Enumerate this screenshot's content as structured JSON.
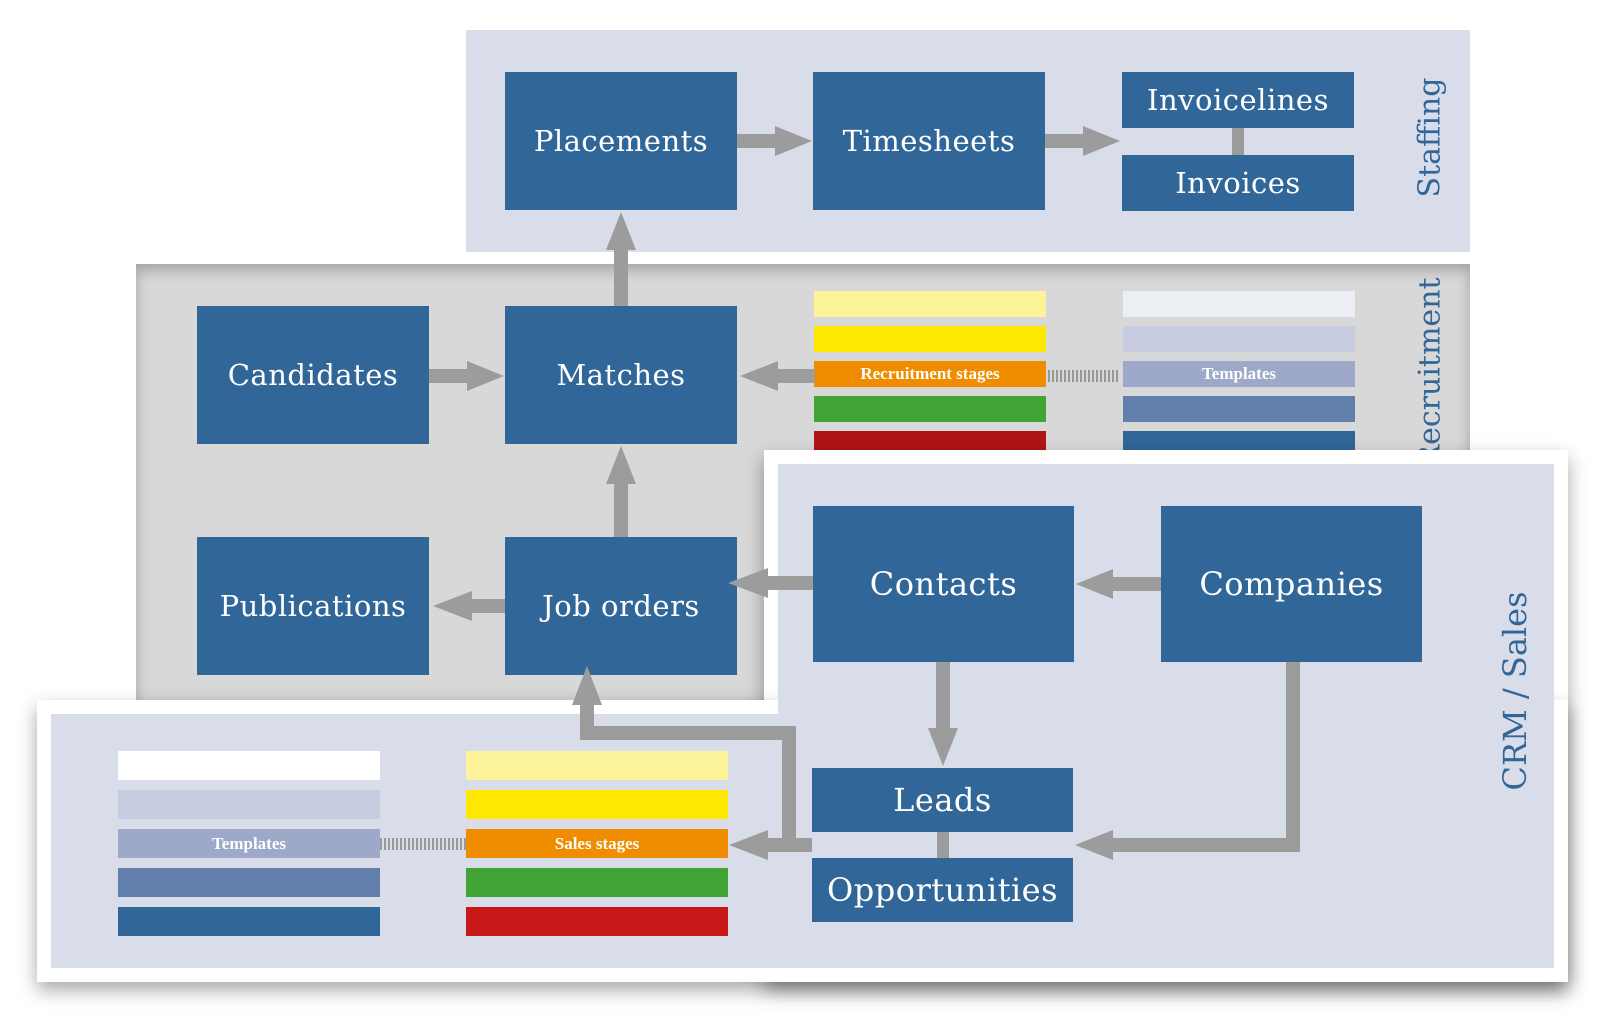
{
  "sections": {
    "staffing": {
      "label": "Staffing",
      "color": "#d9ddea"
    },
    "recruitment": {
      "label": "Recruitment",
      "color": "#d8d8d8"
    },
    "crm_sales": {
      "label": "CRM / Sales",
      "color": "#d9ddea"
    }
  },
  "nodes": {
    "placements": "Placements",
    "timesheets": "Timesheets",
    "invoicelines": "Invoicelines",
    "invoices": "Invoices",
    "candidates": "Candidates",
    "matches": "Matches",
    "publications": "Publications",
    "job_orders": "Job orders",
    "contacts": "Contacts",
    "companies": "Companies",
    "leads": "Leads",
    "opportunities": "Opportunities"
  },
  "stacks": {
    "recruitment_stages": {
      "label": "Recruitment stages",
      "colors": [
        "#fdf39a",
        "#ffe800",
        "#f08c00",
        "#40a535",
        "#b01515"
      ]
    },
    "recruitment_templates": {
      "label": "Templates",
      "colors": [
        "#eceef5",
        "#c7cbe0",
        "#9ea8c8",
        "#627fac",
        "#316699"
      ]
    },
    "sales_templates": {
      "label": "Templates",
      "colors": [
        "#ffffff",
        "#c7cbe0",
        "#9ea8c8",
        "#627fac",
        "#316699"
      ]
    },
    "sales_stages": {
      "label": "Sales stages",
      "colors": [
        "#fdf39a",
        "#ffe800",
        "#f08c00",
        "#40a535",
        "#c81818"
      ]
    }
  },
  "colors": {
    "node": "#316699",
    "arrow": "#9c9c9c",
    "label": "#316699"
  }
}
